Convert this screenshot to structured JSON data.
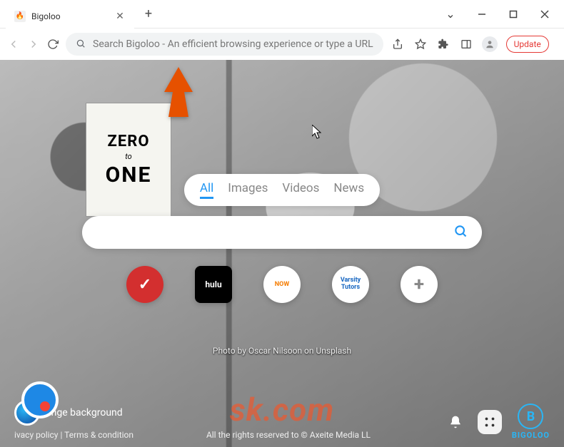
{
  "window": {
    "tab_title": "Bigoloo",
    "controls": {
      "chevron": "⌄",
      "min": "—",
      "max": "☐",
      "close": "✕"
    }
  },
  "toolbar": {
    "omnibox_placeholder": "Search Bigoloo - An efficient browsing experience or type a URL",
    "update_label": "Update"
  },
  "book": {
    "line1": "ZERO",
    "line2": "to",
    "line3": "ONE"
  },
  "search_tabs": {
    "items": [
      "All",
      "Images",
      "Videos",
      "News"
    ],
    "active_index": 0
  },
  "searchbar": {
    "placeholder": ""
  },
  "quick_links": {
    "items": [
      {
        "name": "checkmark",
        "label": "✓"
      },
      {
        "name": "hulu",
        "label": "hulu"
      },
      {
        "name": "shopping-now",
        "label": "NOW"
      },
      {
        "name": "varsity-tutors",
        "label": "Varsity\nTutors"
      },
      {
        "name": "add",
        "label": "+"
      }
    ]
  },
  "credit": "Photo by Oscar Nilsoon on Unsplash",
  "bottom": {
    "change_bg": "ange background",
    "footer_links": "ivacy policy | Terms & condition",
    "rights": "All the rights reserved to © Axeite Media LL",
    "logo_text": "BIGOLOO"
  },
  "watermark": "sk.com"
}
